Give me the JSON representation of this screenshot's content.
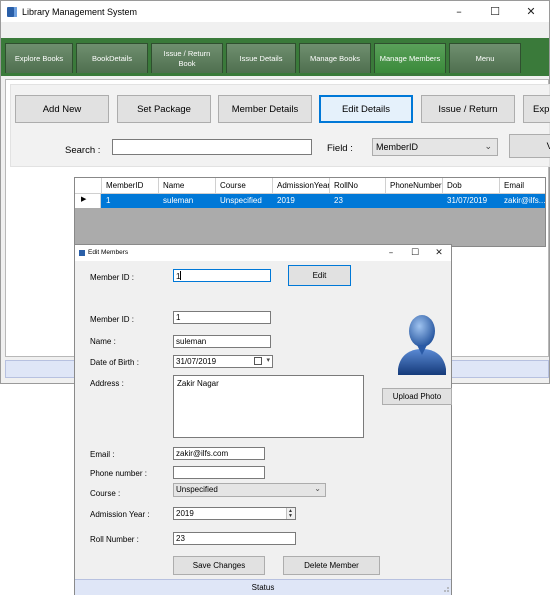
{
  "app": {
    "title": "Library Management System",
    "icon": "book-icon"
  },
  "window_controls": {
    "minimize": "–",
    "maximize": "☐",
    "close": "✕"
  },
  "tabs": [
    {
      "label": "Explore Books"
    },
    {
      "label": "BookDetails"
    },
    {
      "label": "Issue / Return Book"
    },
    {
      "label": "Issue Details"
    },
    {
      "label": "Manage Books"
    },
    {
      "label": "Manage Members",
      "active": true
    },
    {
      "label": "Menu"
    }
  ],
  "toolbar": {
    "add_new": "Add New",
    "set_package": "Set Package",
    "member_details": "Member Details",
    "edit_details": "Edit Details",
    "issue_return": "Issue / Return",
    "export": "Exp"
  },
  "search": {
    "label": "Search :",
    "value": "",
    "field_label": "Field :",
    "field_value": "MemberID",
    "button_partial": "V"
  },
  "grid": {
    "columns": [
      "MemberID",
      "Name",
      "Course",
      "AdmissionYear",
      "RollNo",
      "PhoneNumber",
      "Dob",
      "Email"
    ],
    "rows": [
      {
        "MemberID": "1",
        "Name": "suleman",
        "Course": "Unspecified",
        "AdmissionYear": "2019",
        "RollNo": "23",
        "PhoneNumber": "",
        "Dob": "31/07/2019",
        "Email": "zakir@ilfs..."
      }
    ]
  },
  "dialog": {
    "title": "Edit Members",
    "lookup": {
      "label": "Member ID :",
      "value": "1",
      "edit_button": "Edit"
    },
    "member_id": {
      "label": "Member ID :",
      "value": "1"
    },
    "name": {
      "label": "Name :",
      "value": "suleman"
    },
    "dob": {
      "label": "Date of Birth :",
      "value": "31/07/2019"
    },
    "address": {
      "label": "Address :",
      "value": "Zakir Nagar"
    },
    "upload_photo": "Upload Photo",
    "email": {
      "label": "Email :",
      "value": "zakir@ilfs.com"
    },
    "phone": {
      "label": "Phone number :",
      "value": ""
    },
    "course": {
      "label": "Course :",
      "value": "Unspecified"
    },
    "admission_year": {
      "label": "Admission Year :",
      "value": "2019"
    },
    "roll_number": {
      "label": "Roll Number :",
      "value": "23"
    },
    "save_button": "Save Changes",
    "delete_button": "Delete Member",
    "status": "Status"
  }
}
